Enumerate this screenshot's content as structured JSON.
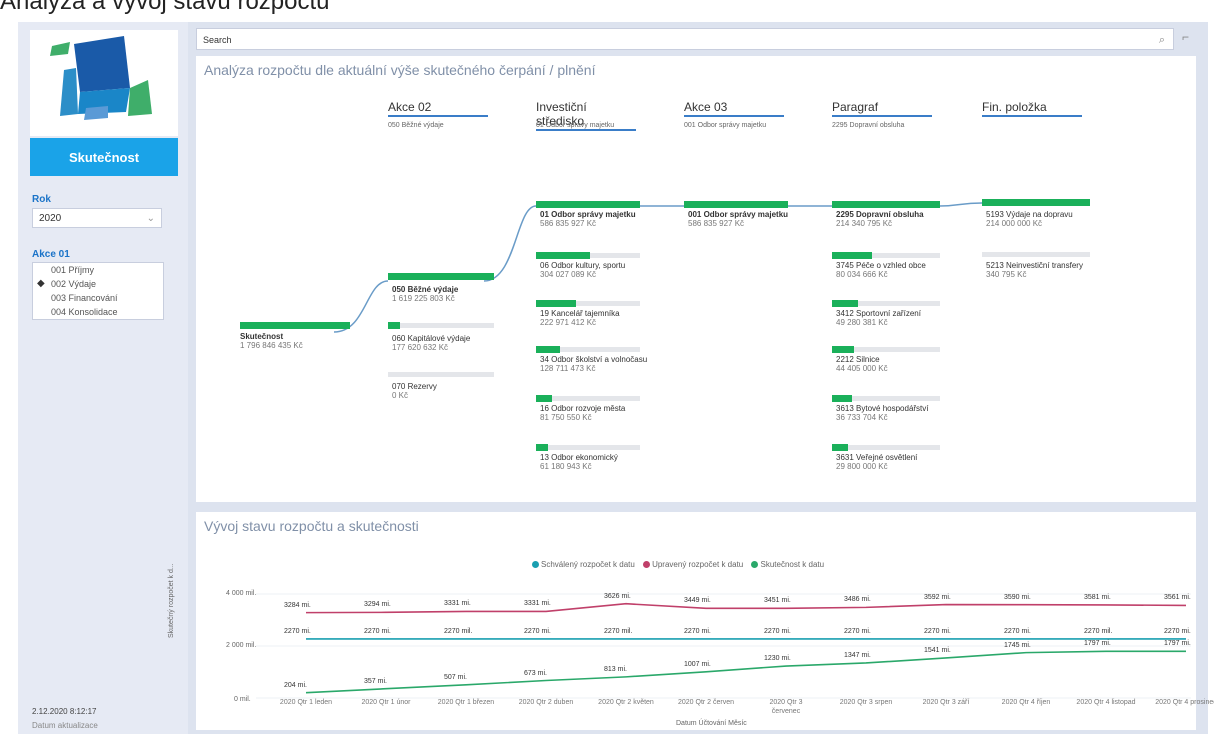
{
  "page_title": "Analýza a vývoj stavu rozpočtu",
  "sidebar": {
    "button": "Skutečnost",
    "rok_label": "Rok",
    "rok_value": "2020",
    "akce_label": "Akce 01",
    "akce_items": [
      "001 Příjmy",
      "002 Výdaje",
      "003 Financování",
      "004 Konsolidace"
    ],
    "timestamp": "2.12.2020 8:12:17",
    "timestamp_sub": "Datum aktualizace"
  },
  "search": {
    "placeholder": "Search"
  },
  "tree": {
    "title": "Analýza rozpočtu dle aktuální výše skutečného čerpání / plnění",
    "columns": [
      {
        "name": "Akce 02",
        "sub": "050 Běžné výdaje"
      },
      {
        "name": "Investiční středisko",
        "sub": "01 Odbor správy majetku"
      },
      {
        "name": "Akce 03",
        "sub": "001 Odbor správy majetku"
      },
      {
        "name": "Paragraf",
        "sub": "2295 Dopravní obsluha"
      },
      {
        "name": "Fin. položka",
        "sub": ""
      }
    ],
    "root": {
      "name": "Skutečnost",
      "value": "1 796 846 435 Kč"
    },
    "col1": [
      {
        "name": "050 Běžné výdaje",
        "value": "1 619 225 803 Kč"
      },
      {
        "name": "060 Kapitálové výdaje",
        "value": "177 620 632 Kč"
      },
      {
        "name": "070 Rezervy",
        "value": "0 Kč"
      }
    ],
    "col2": [
      {
        "name": "01 Odbor správy majetku",
        "value": "586 835 927 Kč"
      },
      {
        "name": "06 Odbor kultury, sportu",
        "value": "304 027 089 Kč"
      },
      {
        "name": "19 Kancelář tajemníka",
        "value": "222 971 412 Kč"
      },
      {
        "name": "34 Odbor školství a volnočasu",
        "value": "128 711 473 Kč"
      },
      {
        "name": "16 Odbor rozvoje města",
        "value": "81 750 550 Kč"
      },
      {
        "name": "13 Odbor ekonomický",
        "value": "61 180 943 Kč"
      }
    ],
    "col3": [
      {
        "name": "001 Odbor správy majetku",
        "value": "586 835 927 Kč"
      }
    ],
    "col4": [
      {
        "name": "2295 Dopravní obsluha",
        "value": "214 340 795 Kč"
      },
      {
        "name": "3745 Péče o vzhled obce",
        "value": "80 034 666 Kč"
      },
      {
        "name": "3412 Sportovní zařízení",
        "value": "49 280 381 Kč"
      },
      {
        "name": "2212 Silnice",
        "value": "44 405 000 Kč"
      },
      {
        "name": "3613 Bytové hospodářství",
        "value": "36 733 704 Kč"
      },
      {
        "name": "3631 Veřejné osvětlení",
        "value": "29 800 000 Kč"
      }
    ],
    "col5": [
      {
        "name": "5193 Výdaje na dopravu",
        "value": "214 000 000 Kč"
      },
      {
        "name": "5213 Neinvestiční transfery",
        "value": "340 795 Kč"
      }
    ]
  },
  "chart_data": {
    "type": "line",
    "title": "Vývoj stavu rozpočtu a skutečnosti",
    "xlabel": "Datum Účtování Měsíc",
    "ylabel": "Skutečný rozpočet k d...",
    "ylim": [
      0,
      4000
    ],
    "yticks": [
      "4 000 mil.",
      "2 000 mil.",
      "0 mil."
    ],
    "categories": [
      "2020 Qtr 1 leden",
      "2020 Qtr 1 únor",
      "2020 Qtr 1 březen",
      "2020 Qtr 2 duben",
      "2020 Qtr 2 květen",
      "2020 Qtr 2 červen",
      "2020 Qtr 3 červenec",
      "2020 Qtr 3 srpen",
      "2020 Qtr 3 září",
      "2020 Qtr 4 říjen",
      "2020 Qtr 4 listopad",
      "2020 Qtr 4 prosinec"
    ],
    "series": [
      {
        "name": "Schválený rozpočet k datu",
        "color": "#1a9fb0",
        "values": [
          2270,
          2270,
          2270,
          2270,
          2270,
          2270,
          2270,
          2270,
          2270,
          2270,
          2270,
          2270
        ],
        "labels": [
          "2270 mi.",
          "2270 mi.",
          "2270 mil.",
          "2270 mi.",
          "2270 mil.",
          "2270 mi.",
          "2270 mi.",
          "2270 mi.",
          "2270 mi.",
          "2270 mi.",
          "2270 mil.",
          "2270 mi."
        ]
      },
      {
        "name": "Upravený rozpočet k datu",
        "color": "#c0406a",
        "values": [
          3284,
          3294,
          3331,
          3331,
          3626,
          3449,
          3451,
          3486,
          3592,
          3590,
          3581,
          3561
        ],
        "labels": [
          "3284 mi.",
          "3294 mi.",
          "3331 mi.",
          "3331 mi.",
          "3626 mi.",
          "3449 mi.",
          "3451 mi.",
          "3486 mi.",
          "3592 mi.",
          "3590 mi.",
          "3581 mi.",
          "3561 mi."
        ]
      },
      {
        "name": "Skutečnost k datu",
        "color": "#2aa86a",
        "values": [
          204,
          357,
          507,
          673,
          813,
          1007,
          1230,
          1347,
          1541,
          1745,
          1797,
          1797
        ],
        "labels": [
          "204 mi.",
          "357 mi.",
          "507 mi.",
          "673 mi.",
          "813 mi.",
          "1007 mi.",
          "1230 mi.",
          "1347 mi.",
          "1541 mi.",
          "1745 mi.",
          "1797 mi.",
          "1797 mi."
        ]
      }
    ],
    "legend": "top-center"
  }
}
